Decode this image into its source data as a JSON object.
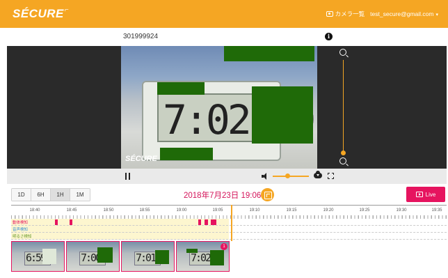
{
  "header": {
    "logo": "SÉCURE",
    "camera_list_label": "カメラ一覧",
    "user_email": "test_secure@gmail.com",
    "accent_color": "#f5a623"
  },
  "camera": {
    "id": "301999924"
  },
  "video": {
    "clock_digits": "7:02:19",
    "overlay_logo": "SÉCURE"
  },
  "controls": {
    "zoom_level": 0.08,
    "volume_level": 0.35
  },
  "timeline": {
    "ranges": [
      "1D",
      "6H",
      "1H",
      "1M"
    ],
    "active_range": "1H",
    "datetime": "2018年7月23日 19:06:48",
    "live_label": "Live",
    "ticks": [
      "18:40",
      "18:45",
      "18:50",
      "18:55",
      "19:00",
      "19:05",
      "19:10",
      "19:15",
      "19:20",
      "19:25",
      "19:30",
      "19:35"
    ],
    "tracks": [
      {
        "label": "動体検知",
        "color": "#e6145f"
      },
      {
        "label": "音声検知",
        "color": "#3a8fd6"
      },
      {
        "label": "明るさ検知",
        "color": "#6b9b2c"
      }
    ],
    "highlight_color": "#e6145f"
  },
  "thumbnails": {
    "badge": "1"
  }
}
